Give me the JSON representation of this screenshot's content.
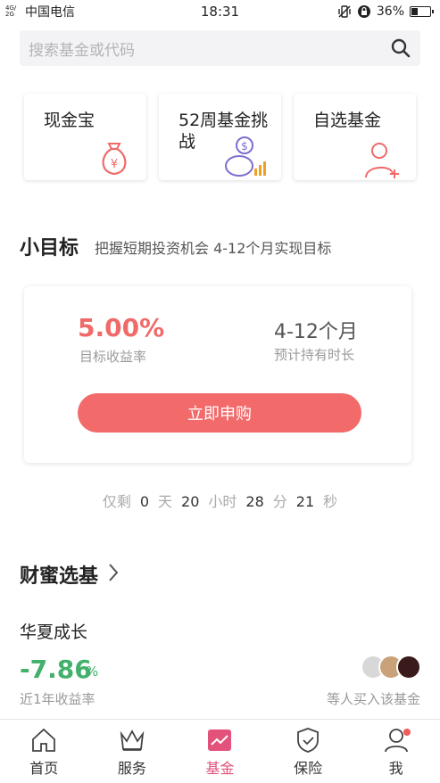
{
  "status_bar": {
    "network": "4G/ 2G",
    "carrier": "中国电信",
    "time": "18:31",
    "battery": "36%",
    "battery_level": 0.36
  },
  "search": {
    "placeholder": "搜索基金或代码",
    "icon": "search-icon"
  },
  "quick_cards": [
    {
      "label": "现金宝",
      "icon": "money-bag-icon"
    },
    {
      "label": "52周基金挑战",
      "icon": "piggy-bank-icon"
    },
    {
      "label": "自选基金",
      "icon": "add-user-icon"
    }
  ],
  "goal_section": {
    "title": "小目标",
    "subtitle": "把握短期投资机会 4-12个月实现目标",
    "rate": "5.00%",
    "rate_label": "目标收益率",
    "duration": "4-12个月",
    "duration_label": "预计持有时长",
    "button": "立即申购"
  },
  "countdown": {
    "prefix": "仅剩",
    "days": "0",
    "days_unit": "天",
    "hours": "20",
    "hours_unit": "小时",
    "minutes": "28",
    "minutes_unit": "分",
    "seconds": "21",
    "seconds_unit": "秒"
  },
  "pick_section": {
    "title": "财蜜选基",
    "fund_name": "华夏成长",
    "rate": "-7.86",
    "rate_unit": "%",
    "rate_label": "近1年收益率",
    "buyers_text": "等人买入该基金"
  },
  "tabs": [
    {
      "label": "首页",
      "icon": "home-icon"
    },
    {
      "label": "服务",
      "icon": "crown-icon"
    },
    {
      "label": "基金",
      "icon": "chart-icon",
      "active": true
    },
    {
      "label": "保险",
      "icon": "shield-icon"
    },
    {
      "label": "我",
      "icon": "user-icon"
    }
  ],
  "colors": {
    "accent": "#f26a6a",
    "active_tab": "#e2527b",
    "positive": "#43b06c"
  }
}
